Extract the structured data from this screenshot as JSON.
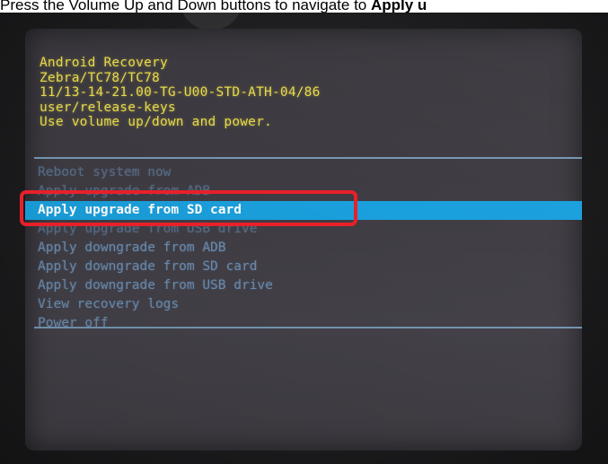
{
  "caption": {
    "prefix": "Press the Volume Up and Down buttons to navigate to ",
    "bold": "Apply u"
  },
  "recovery": {
    "header_lines": [
      "Android Recovery",
      "Zebra/TC78/TC78",
      "11/13-14-21.00-TG-U00-STD-ATH-04/86",
      "user/release-keys",
      "Use volume up/down and power."
    ],
    "menu_items": [
      "Reboot system now",
      "Apply upgrade from ADB",
      "Apply upgrade from SD card",
      "Apply upgrade from USB drive",
      "Apply downgrade from ADB",
      "Apply downgrade from SD card",
      "Apply downgrade from USB drive",
      "View recovery logs",
      "Power off"
    ],
    "selected_item": "Apply upgrade from SD card"
  },
  "colors": {
    "header_text": "#e6d84a",
    "menu_text": "#6d8fb3",
    "selection_bar": "#1aa0dd",
    "annotation_box": "#e8202a",
    "divider": "#7fa9c9"
  }
}
